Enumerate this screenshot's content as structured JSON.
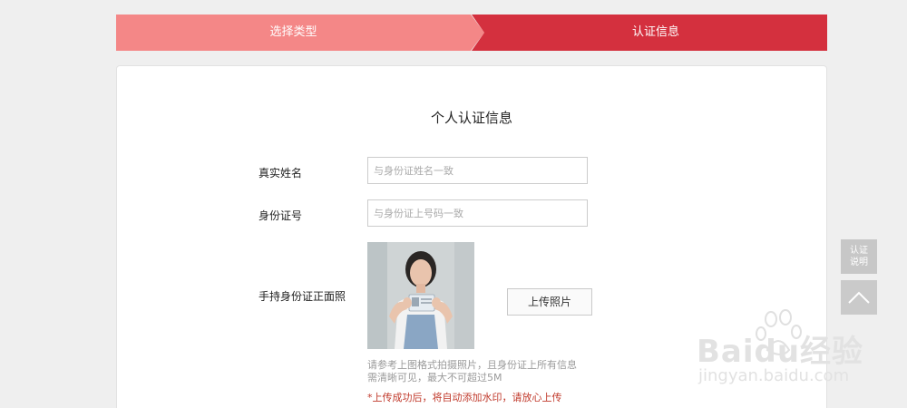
{
  "steps": {
    "step1": "选择类型",
    "step2": "认证信息"
  },
  "form": {
    "title": "个人认证信息",
    "name_label": "真实姓名",
    "name_placeholder": "与身份证姓名一致",
    "id_label": "身份证号",
    "id_placeholder": "与身份证上号码一致",
    "photo_label": "手持身份证正面照",
    "upload_label": "上传照片",
    "hint_line1": "请参考上图格式拍摄照片，且身份证上所有信息",
    "hint_line2": "需清晰可见，最大不可超过5M",
    "warning": "*上传成功后，将自动添加水印，请放心上传"
  },
  "side": {
    "help_label_1": "认证",
    "help_label_2": "说明"
  },
  "watermark": {
    "brand": "Baidu经验",
    "url": "jingyan.baidu.com"
  },
  "colors": {
    "step_inactive": "#f48787",
    "step_active": "#d4303e",
    "warning": "#c0392b"
  }
}
